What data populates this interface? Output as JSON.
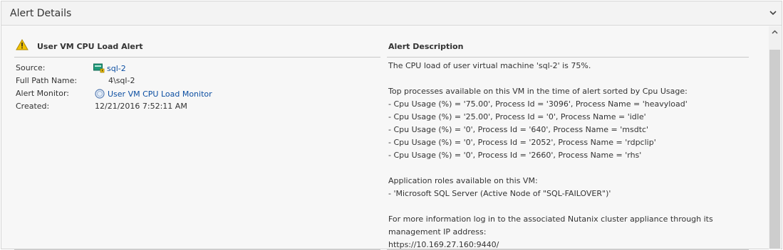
{
  "header": {
    "title": "Alert Details",
    "collapse_icon": "chevron-down-icon"
  },
  "alert": {
    "title": "User VM CPU Load Alert",
    "icon": "warning-icon",
    "properties": [
      {
        "label": "Source:",
        "value": "sql-2",
        "icon": "vm-icon",
        "link": true
      },
      {
        "label": "Full Path Name:",
        "value": "4\\sql-2",
        "link": false
      },
      {
        "label": "Alert Monitor:",
        "value": "User VM CPU Load Monitor",
        "icon": "monitor-icon",
        "link": true
      },
      {
        "label": "Created:",
        "value": "12/21/2016 7:52:11 AM",
        "link": false
      }
    ]
  },
  "description": {
    "title": "Alert Description",
    "text": "The CPU load of user virtual machine 'sql-2' is 75%.\n\nTop processes available on this VM in the time of alert sorted by Cpu Usage:\n- Cpu Usage (%) = '75.00', Process Id = '3096', Process Name = 'heavyload'\n- Cpu Usage (%) = '25.00', Process Id = '0', Process Name = 'idle'\n- Cpu Usage (%) = '0', Process Id = '640', Process Name = 'msdtc'\n- Cpu Usage (%) = '0', Process Id = '2052', Process Name = 'rdpclip'\n- Cpu Usage (%) = '0', Process Id = '2660', Process Name = 'rhs'\n\nApplication roles available on this VM:\n- 'Microsoft SQL Server (Active Node of \"SQL-FAILOVER\")'\n\nFor more information log in to the associated Nutanix cluster appliance through its management IP address:\nhttps://10.169.27.160:9440/"
  },
  "colors": {
    "link": "#0b4ea2",
    "warning": "#f2c200",
    "vm_icon": "#1f9a7a"
  }
}
